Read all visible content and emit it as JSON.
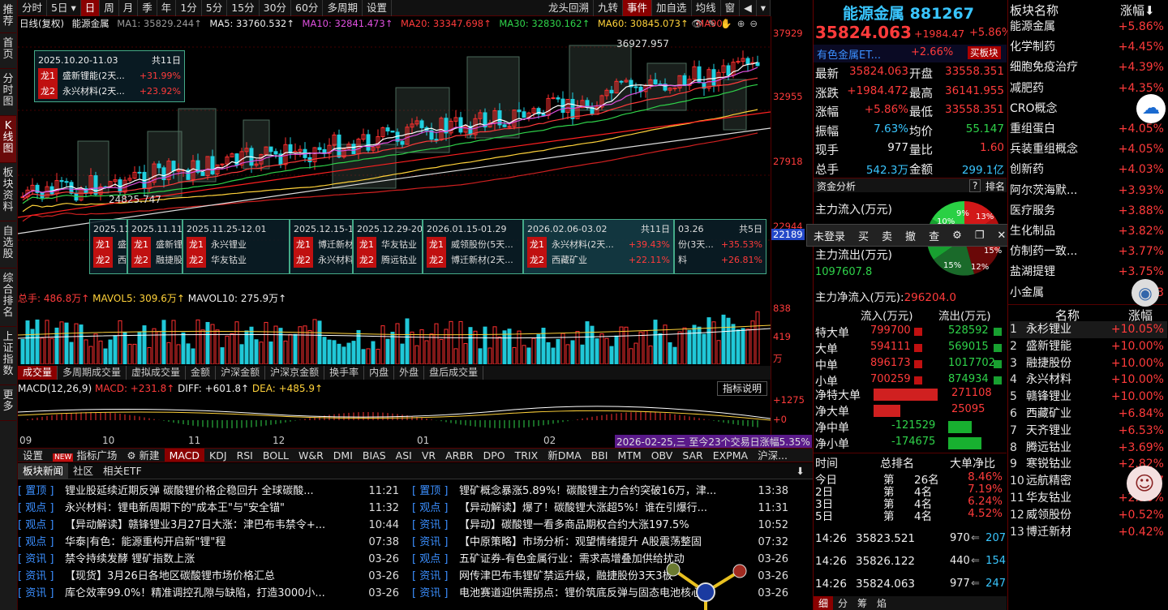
{
  "left_nav": [
    "推荐",
    "首页",
    "分时图",
    "K线图",
    "板块资料",
    "自选股",
    "综合排名",
    "上证指数",
    "更多"
  ],
  "left_nav_active": 3,
  "top_tabs": [
    "分时",
    "5日",
    "日",
    "周",
    "月",
    "季",
    "年",
    "1分",
    "5分",
    "15分",
    "30分",
    "60分",
    "多周期",
    "设置"
  ],
  "top_tab_active": 2,
  "top_right": [
    "龙头回溯",
    "九转",
    "事件",
    "加自选",
    "均线",
    "窗"
  ],
  "chart_head": {
    "period": "日线(复权)",
    "name": "能源金属",
    "ma1": "MA1: 35829.244↑",
    "ma5": "MA5: 33760.532↑",
    "ma10": "MA10: 32841.473↑",
    "ma20": "MA20: 33347.698↑",
    "ma30": "MA30: 32830.162↑",
    "ma60": "MA60: 30845.073↑",
    "ma90": "MA90:"
  },
  "price_axis": [
    "37929",
    "32955",
    "27918",
    "22944",
    "22189"
  ],
  "high_label": "36927.957",
  "low_label": "24825.747",
  "top_bubble": {
    "range": "2025.10.20-11.03",
    "days": "共11日",
    "rows": [
      {
        "tag": "龙1",
        "name": "盛新锂能(2天...",
        "pct": "+31.99%"
      },
      {
        "tag": "龙2",
        "name": "永兴材料(2天...",
        "pct": "+23.92%"
      }
    ]
  },
  "bottom_bubbles": [
    {
      "range": "2025.11",
      "r1": "盛",
      "r2": "西"
    },
    {
      "range": "2025.11.11",
      "r1": "盛新锂",
      "r2": "融捷股"
    },
    {
      "range": "2025.11.25-12.01",
      "r1": "永兴锂业",
      "r2": "华友钴业"
    },
    {
      "range": "2025.12.15-1",
      "r1": "博迁新材",
      "r2": "永兴材料"
    },
    {
      "range": "2025.12.29-20",
      "r1": "华友钴业",
      "r2": "腾远钴业"
    },
    {
      "range": "2026.01.15-01.29",
      "r1": "威领股份(5天...",
      "r2": "博迁新材(2天..."
    },
    {
      "range": "2026.02.06-03.02",
      "days": "共11日",
      "r1": "永兴材料(2天...",
      "p1": "+39.43%",
      "r2": "西藏矿业",
      "p2": "+22.11%"
    },
    {
      "range": "03.26",
      "days": "共5日",
      "r1": "份(3天...",
      "p1": "+35.53%",
      "r2": "料",
      "p2": "+26.81%"
    }
  ],
  "vol_head": {
    "total": "总手: 486.8万↑",
    "mavol5": "MAVOL5: 309.6万↑",
    "mavol10": "MAVOL10: 275.9万↑"
  },
  "vol_axis": [
    "838",
    "419",
    "万"
  ],
  "vol_tabs": [
    "成交量",
    "多周期成交量",
    "虚拟成交量",
    "金额",
    "沪深金额",
    "沪深京金额",
    "换手率",
    "内盘",
    "外盘",
    "盘后成交量"
  ],
  "macd_head": {
    "name": "MACD(12,26,9)",
    "macd": "MACD: +231.8↑",
    "diff": "DIFF: +601.8↑",
    "dea": "DEA: +485.9↑",
    "btn": "指标说明"
  },
  "macd_axis": [
    "+1275",
    "+0"
  ],
  "dates": [
    "09",
    "10",
    "11",
    "12",
    "01",
    "02"
  ],
  "date_note": "2026-02-25,三 至今23个交易日涨幅5.35%",
  "ind_tabs": [
    "设置",
    "指标广场",
    "新建",
    "MACD",
    "KDJ",
    "RSI",
    "BOLL",
    "W&R",
    "DMI",
    "BIAS",
    "ASI",
    "VR",
    "ARBR",
    "DPO",
    "TRIX",
    "新DMA",
    "BBI",
    "MTM",
    "OBV",
    "SAR",
    "EXPMA",
    "沪深..."
  ],
  "ind_new_badge": "NEW",
  "news_tabs": [
    "板块新闻",
    "社区",
    "相关ETF"
  ],
  "news_left": [
    {
      "cat": "[ 置顶 ]",
      "title": "锂业股延续近期反弹 碳酸锂价格企稳回升 全球碳酸...",
      "time": "11:21"
    },
    {
      "cat": "[ 观点 ]",
      "title": "永兴材料：锂电新周期下的\"成本王\"与\"安全锚\"",
      "time": "11:32"
    },
    {
      "cat": "[ 观点 ]",
      "title": "【异动解读】赣锋锂业3月27日大涨：津巴布韦禁令+...",
      "time": "10:44"
    },
    {
      "cat": "[ 观点 ]",
      "title": "华泰|有色：能源重构开启新\"锂\"程",
      "time": "07:38"
    },
    {
      "cat": "[ 资讯 ]",
      "title": "禁令持续发酵 锂矿指数上涨",
      "time": "03-26"
    },
    {
      "cat": "[ 资讯 ]",
      "title": "【现货】3月26日各地区碳酸锂市场价格汇总",
      "time": "03-26"
    },
    {
      "cat": "[ 资讯 ]",
      "title": "库仑效率99.0%！精准调控孔隙与缺陷，打造3000小...",
      "time": "03-26"
    }
  ],
  "news_right": [
    {
      "cat": "[ 置顶 ]",
      "title": "锂矿概念暴涨5.89%！碳酸锂主力合约突破16万，津...",
      "time": "13:38"
    },
    {
      "cat": "[ 观点 ]",
      "title": "【异动解读】爆了！碳酸锂大涨超5%！谁在引爆行...",
      "time": "11:31"
    },
    {
      "cat": "[ 资讯 ]",
      "title": "【异动】碳酸锂一看多商品期权合约大涨197.5%",
      "time": "10:52"
    },
    {
      "cat": "[ 资讯 ]",
      "title": "【中原策略】市场分析：观望情绪提升 A股震荡整固",
      "time": "07:32"
    },
    {
      "cat": "[ 观点 ]",
      "title": "五矿证券-有色金属行业：需求高增叠加供给扰动",
      "time": "03-26"
    },
    {
      "cat": "[ 资讯 ]",
      "title": "网传津巴布韦锂矿禁运升级，融捷股份3天3板",
      "time": "03-26"
    },
    {
      "cat": "[ 资讯 ]",
      "title": "电池赛道迎供需拐点：锂价筑底反弹与固态电池核心...",
      "time": "03-26"
    }
  ],
  "quote": {
    "name": "能源金属",
    "code": "881267",
    "price": "35824.063",
    "chg": "+1984.47",
    "pct": "+5.86%",
    "etf": "有色金属ET...",
    "etf_pct": "+2.66%",
    "buy_btn": "买板块",
    "rows": [
      [
        "最新",
        "35824.063",
        "开盘",
        "33558.351"
      ],
      [
        "涨跌",
        "+1984.472",
        "最高",
        "36141.955"
      ],
      [
        "涨幅",
        "+5.86%",
        "最低",
        "33558.351"
      ],
      [
        "振幅",
        "7.63%",
        "均价",
        "55.147"
      ],
      [
        "现手",
        "977",
        "量比",
        "1.60"
      ],
      [
        "总手",
        "542.3万",
        "金额",
        "299.1亿"
      ]
    ]
  },
  "fund": {
    "title": "资金分析",
    "help": "?",
    "rank": "排名",
    "in_label": "主力流入(万元)",
    "out_label": "主力流出(万元)",
    "out_val": "1097607.8",
    "net_label": "主力净流入(万元):",
    "net_val": "296204.0",
    "pie": [
      "9%",
      "13%",
      "10%",
      "15%",
      "15%",
      "12%"
    ],
    "table_head": [
      "流入(万元)",
      "流出(万元)"
    ],
    "table": [
      [
        "特大单",
        "799700",
        "528592"
      ],
      [
        "大单",
        "594111",
        "569015"
      ],
      [
        "中单",
        "896173",
        "1017702"
      ],
      [
        "小单",
        "700259",
        "874934"
      ]
    ],
    "net": [
      [
        "净特大单",
        "271108"
      ],
      [
        "净大单",
        "25095"
      ],
      [
        "净中单",
        "-121529"
      ],
      [
        "净小单",
        "-174675"
      ]
    ],
    "rank_head": [
      "时间",
      "总排名",
      "大单净比"
    ],
    "rank_rows": [
      [
        "今日",
        "第",
        "26名",
        "8.46%"
      ],
      [
        "2日",
        "第",
        "4名",
        "7.19%"
      ],
      [
        "3日",
        "第",
        "4名",
        "6.24%"
      ],
      [
        "5日",
        "第",
        "4名",
        "4.52%"
      ]
    ],
    "ticks": [
      [
        "14:26",
        "35823.521",
        "970",
        "207"
      ],
      [
        "14:26",
        "35826.122",
        "440",
        "154"
      ],
      [
        "14:26",
        "35824.063",
        "977",
        "247"
      ]
    ],
    "bottom_tabs": [
      "细",
      "分",
      "筹",
      "焰"
    ]
  },
  "popup": [
    "未登录",
    "买",
    "卖",
    "撤",
    "查",
    "⚙",
    "❐",
    "✕"
  ],
  "sector_head": [
    "板块名称",
    "涨幅"
  ],
  "sectors": [
    [
      "能源金属",
      "+5.86%"
    ],
    [
      "化学制药",
      "+4.45%"
    ],
    [
      "细胞免疫治疗",
      "+4.39%"
    ],
    [
      "减肥药",
      "+4.35%"
    ],
    [
      "CRO概念",
      "+4.2"
    ],
    [
      "重组蛋白",
      "+4.05%"
    ],
    [
      "兵装重组概念",
      "+4.05%"
    ],
    [
      "创新药",
      "+4.03%"
    ],
    [
      "阿尔茨海默...",
      "+3.93%"
    ],
    [
      "医疗服务",
      "+3.88%"
    ],
    [
      "生化制品",
      "+3.82%"
    ],
    [
      "仿制药一致...",
      "+3.77%"
    ],
    [
      "盐湖提锂",
      "+3.75%"
    ],
    [
      "小金属",
      "+3"
    ]
  ],
  "stock_head": [
    "名称",
    "涨幅"
  ],
  "stocks": [
    [
      "1",
      "永杉锂业",
      "+10.05%"
    ],
    [
      "2",
      "盛新锂能",
      "+10.00%"
    ],
    [
      "3",
      "融捷股份",
      "+10.00%"
    ],
    [
      "4",
      "永兴材料",
      "+10.00%"
    ],
    [
      "5",
      "赣锋锂业",
      "+10.00%"
    ],
    [
      "6",
      "西藏矿业",
      "+6.84%"
    ],
    [
      "7",
      "天齐锂业",
      "+6.53%"
    ],
    [
      "8",
      "腾远钴业",
      "+3.69%"
    ],
    [
      "9",
      "寒锐钴业",
      "+2.82%"
    ],
    [
      "10",
      "远航精密",
      "+2.7"
    ],
    [
      "11",
      "华友钴业",
      "+2.56%"
    ],
    [
      "12",
      "威领股份",
      "+0.52%"
    ],
    [
      "13",
      "博迁新材",
      "+0.42%"
    ]
  ]
}
